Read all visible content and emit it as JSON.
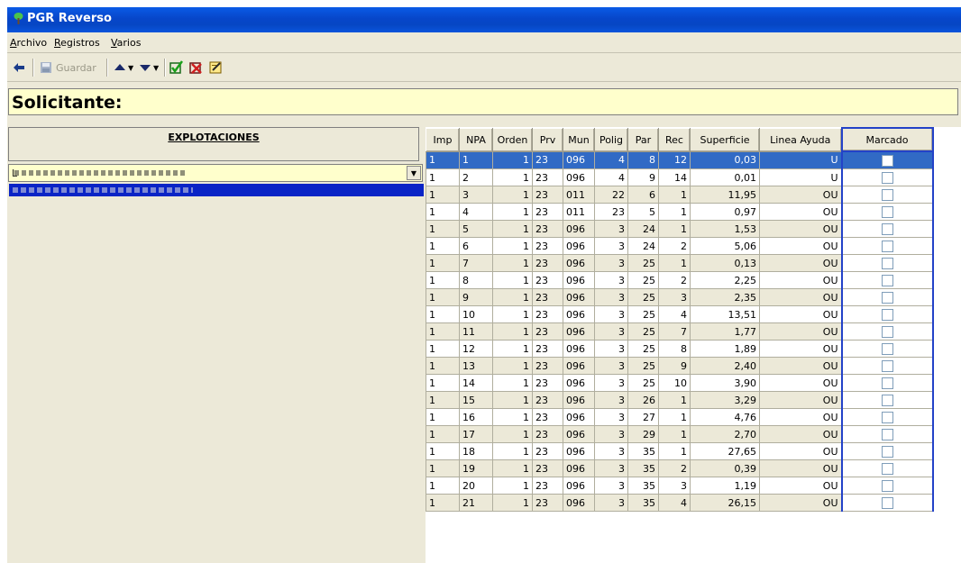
{
  "window": {
    "title": "PGR Reverso"
  },
  "menu": [
    {
      "accel": "A",
      "rest": "rchivo"
    },
    {
      "accel": "R",
      "rest": "egistros"
    },
    {
      "accel": "V",
      "rest": "arios"
    }
  ],
  "toolbar": {
    "save_label": "Guardar"
  },
  "solicitante": {
    "label": "Solicitante:"
  },
  "left_panel": {
    "header": "EXPLOTACIONES",
    "combo_value": "L"
  },
  "grid": {
    "columns": [
      "Imp",
      "NPA",
      "Orden",
      "Prv",
      "Mun",
      "Polig",
      "Par",
      "Rec",
      "Superficie",
      "Linea Ayuda",
      "Marcado"
    ],
    "rows": [
      [
        "1",
        "1",
        "1",
        "23",
        "096",
        "4",
        "8",
        "12",
        "0,03",
        "U"
      ],
      [
        "1",
        "2",
        "1",
        "23",
        "096",
        "4",
        "9",
        "14",
        "0,01",
        "U"
      ],
      [
        "1",
        "3",
        "1",
        "23",
        "011",
        "22",
        "6",
        "1",
        "11,95",
        "OU"
      ],
      [
        "1",
        "4",
        "1",
        "23",
        "011",
        "23",
        "5",
        "1",
        "0,97",
        "OU"
      ],
      [
        "1",
        "5",
        "1",
        "23",
        "096",
        "3",
        "24",
        "1",
        "1,53",
        "OU"
      ],
      [
        "1",
        "6",
        "1",
        "23",
        "096",
        "3",
        "24",
        "2",
        "5,06",
        "OU"
      ],
      [
        "1",
        "7",
        "1",
        "23",
        "096",
        "3",
        "25",
        "1",
        "0,13",
        "OU"
      ],
      [
        "1",
        "8",
        "1",
        "23",
        "096",
        "3",
        "25",
        "2",
        "2,25",
        "OU"
      ],
      [
        "1",
        "9",
        "1",
        "23",
        "096",
        "3",
        "25",
        "3",
        "2,35",
        "OU"
      ],
      [
        "1",
        "10",
        "1",
        "23",
        "096",
        "3",
        "25",
        "4",
        "13,51",
        "OU"
      ],
      [
        "1",
        "11",
        "1",
        "23",
        "096",
        "3",
        "25",
        "7",
        "1,77",
        "OU"
      ],
      [
        "1",
        "12",
        "1",
        "23",
        "096",
        "3",
        "25",
        "8",
        "1,89",
        "OU"
      ],
      [
        "1",
        "13",
        "1",
        "23",
        "096",
        "3",
        "25",
        "9",
        "2,40",
        "OU"
      ],
      [
        "1",
        "14",
        "1",
        "23",
        "096",
        "3",
        "25",
        "10",
        "3,90",
        "OU"
      ],
      [
        "1",
        "15",
        "1",
        "23",
        "096",
        "3",
        "26",
        "1",
        "3,29",
        "OU"
      ],
      [
        "1",
        "16",
        "1",
        "23",
        "096",
        "3",
        "27",
        "1",
        "4,76",
        "OU"
      ],
      [
        "1",
        "17",
        "1",
        "23",
        "096",
        "3",
        "29",
        "1",
        "2,70",
        "OU"
      ],
      [
        "1",
        "18",
        "1",
        "23",
        "096",
        "3",
        "35",
        "1",
        "27,65",
        "OU"
      ],
      [
        "1",
        "19",
        "1",
        "23",
        "096",
        "3",
        "35",
        "2",
        "0,39",
        "OU"
      ],
      [
        "1",
        "20",
        "1",
        "23",
        "096",
        "3",
        "35",
        "3",
        "1,19",
        "OU"
      ],
      [
        "1",
        "21",
        "1",
        "23",
        "096",
        "3",
        "35",
        "4",
        "26,15",
        "OU"
      ]
    ],
    "selected_row": 0
  },
  "colors": {
    "titlebar": "#0a5be6",
    "selection": "#316ac5",
    "marcado_border": "#2342c8",
    "yellow_field": "#ffffcc",
    "face": "#ece9d8"
  }
}
